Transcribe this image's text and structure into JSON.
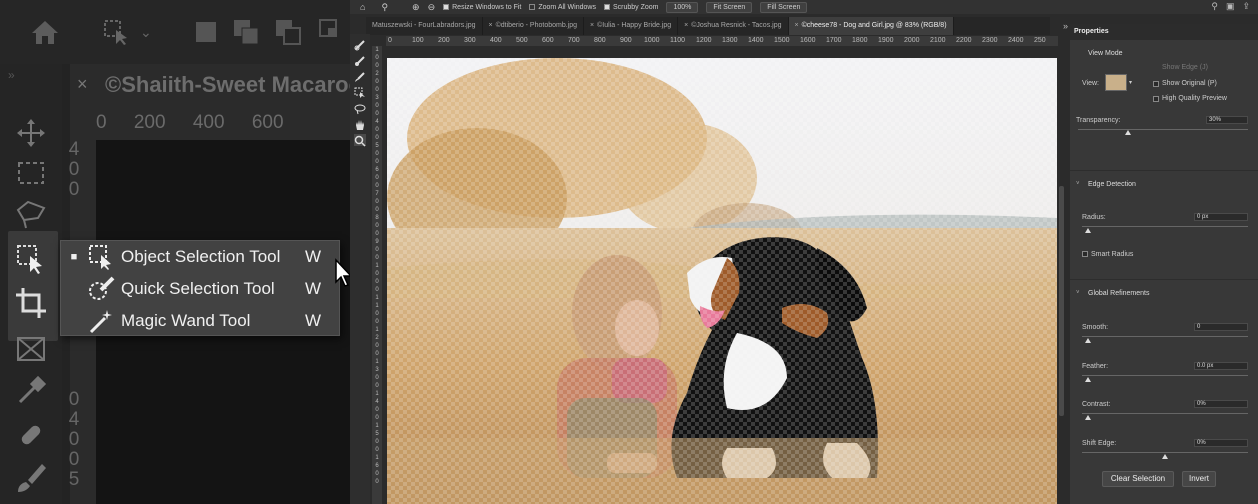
{
  "left_panel": {
    "doc_title": "©Shaiith-Sweet Macaroon",
    "ruler_numbers": [
      "0",
      "200",
      "400",
      "600"
    ],
    "vruler_digits": [
      "4",
      "0",
      "0",
      "5",
      "0",
      "0",
      "0",
      "4",
      "0",
      "0",
      "5",
      "0"
    ],
    "flyout": [
      {
        "label": "Object Selection Tool",
        "shortcut": "W",
        "selected": true
      },
      {
        "label": "Quick Selection Tool",
        "shortcut": "W",
        "selected": false
      },
      {
        "label": "Magic Wand Tool",
        "shortcut": "W",
        "selected": false
      }
    ],
    "flyout_selected_marker": "■"
  },
  "options_bar": {
    "resize_windows": "Resize Windows to Fit",
    "zoom_all": "Zoom All Windows",
    "scrubby_zoom": "Scrubby Zoom",
    "zoom_value": "100%",
    "fit_screen": "Fit Screen",
    "fill_screen": "Fill Screen"
  },
  "tabs": [
    {
      "label": "Matuszewski - FourLabradors.jpg",
      "active": false
    },
    {
      "label": "©dtiberio - Photobomb.jpg",
      "active": false
    },
    {
      "label": "©Iulia - Happy Bride.jpg",
      "active": false
    },
    {
      "label": "©Joshua Resnick - Tacos.jpg",
      "active": false
    },
    {
      "label": "©cheese78 - Dog and Girl.jpg @ 83% (RGB/8)",
      "active": true
    }
  ],
  "hruler_ticks": [
    "0",
    "100",
    "200",
    "300",
    "400",
    "500",
    "600",
    "700",
    "800",
    "900",
    "1000",
    "1100",
    "1200",
    "1300",
    "1400",
    "1500",
    "1600",
    "1700",
    "1800",
    "1900",
    "2000",
    "2100",
    "2200",
    "2300",
    "2400",
    "250"
  ],
  "vruler_digits": [
    "1",
    "0",
    "0",
    "2",
    "0",
    "0",
    "3",
    "0",
    "0",
    "4",
    "0",
    "0",
    "5",
    "0",
    "0",
    "6",
    "0",
    "0",
    "7",
    "0",
    "0",
    "8",
    "0",
    "0",
    "9",
    "0",
    "0",
    "1",
    "0",
    "0",
    "0",
    "1",
    "1",
    "0",
    "0",
    "1",
    "2",
    "0",
    "0",
    "1",
    "3",
    "0",
    "0",
    "1",
    "4",
    "0",
    "0",
    "1",
    "5",
    "0",
    "0",
    "1",
    "6",
    "0",
    "0"
  ],
  "properties": {
    "title": "Properties",
    "view_mode": "View Mode",
    "show_edge": "Show Edge (J)",
    "view_label": "View:",
    "show_original": "Show Original (P)",
    "high_quality": "High Quality Preview",
    "transparency_label": "Transparency:",
    "transparency_value": "30%",
    "transparency": 0.3,
    "edge_detection": "Edge Detection",
    "radius_label": "Radius:",
    "radius_value": "0 px",
    "smart_radius": "Smart Radius",
    "global_refinements": "Global Refinements",
    "smooth_label": "Smooth:",
    "smooth_value": "0",
    "feather_label": "Feather:",
    "feather_value": "0.0 px",
    "contrast_label": "Contrast:",
    "contrast_value": "0%",
    "shift_label": "Shift Edge:",
    "shift_value": "0%",
    "shift": 0.5,
    "clear_selection": "Clear Selection",
    "invert": "Invert"
  }
}
